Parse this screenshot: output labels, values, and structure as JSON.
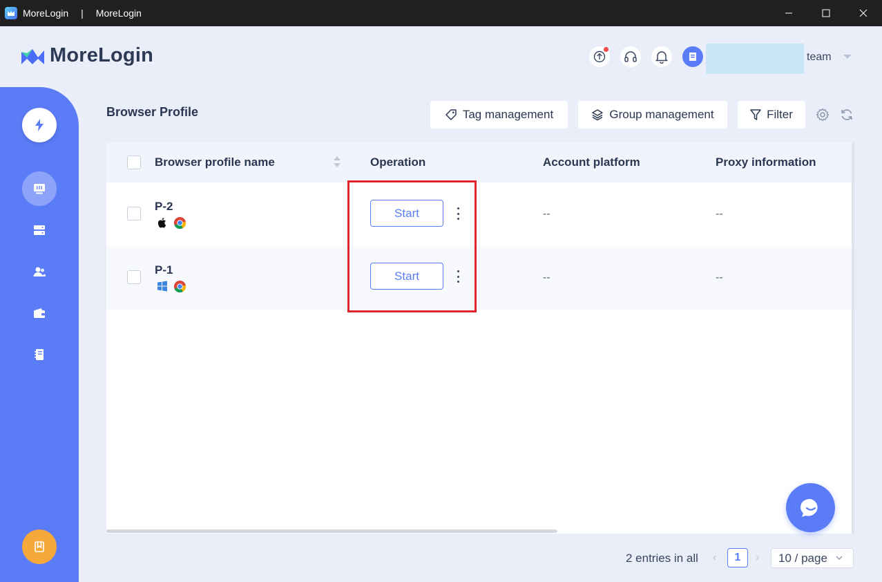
{
  "window": {
    "app_name": "MoreLogin",
    "separator": "|",
    "title": "MoreLogin"
  },
  "header": {
    "logo_text": "MoreLogin",
    "team_label": "team"
  },
  "sidebar": {
    "items": [
      {
        "icon": "lightning-icon"
      },
      {
        "icon": "browser-profile-icon"
      },
      {
        "icon": "server-icon"
      },
      {
        "icon": "team-icon"
      },
      {
        "icon": "wallet-icon"
      },
      {
        "icon": "notebook-icon"
      },
      {
        "icon": "bookmark-icon"
      }
    ]
  },
  "toolbar": {
    "page_title": "Browser Profile",
    "tag_management": "Tag management",
    "group_management": "Group management",
    "filter": "Filter"
  },
  "table": {
    "columns": {
      "name": "Browser profile name",
      "operation": "Operation",
      "account_platform": "Account platform",
      "proxy_information": "Proxy information"
    },
    "rows": [
      {
        "name": "P-2",
        "os": "apple-icon",
        "browser": "chrome-icon",
        "action": "Start",
        "account_platform": "--",
        "proxy": "--"
      },
      {
        "name": "P-1",
        "os": "windows-icon",
        "browser": "chrome-icon",
        "action": "Start",
        "account_platform": "--",
        "proxy": "--"
      }
    ]
  },
  "pagination": {
    "entries": "2 entries in all",
    "current_page": "1",
    "page_size": "10 / page"
  },
  "colors": {
    "accent": "#5b7cf7",
    "highlight": "#e0242c",
    "badge": "#f04a4a",
    "bookmark": "#f7a83b"
  }
}
